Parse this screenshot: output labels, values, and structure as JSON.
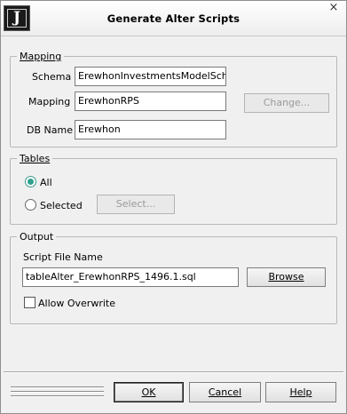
{
  "window": {
    "title": "Generate Alter Scripts",
    "logo_letter": "J",
    "close_symbol": "×"
  },
  "mapping": {
    "legend": "Mapping",
    "schema_label": "Schema",
    "schema_value": "ErewhonInvestmentsModelSchema",
    "mapping_label": "Mapping",
    "mapping_value": "ErewhonRPS",
    "change_button": "Change...",
    "dbname_label": "DB Name",
    "dbname_value": "Erewhon"
  },
  "tables": {
    "legend": "Tables",
    "all_label": "All",
    "all_selected": true,
    "selected_label": "Selected",
    "select_button": "Select..."
  },
  "output": {
    "legend": "Output",
    "script_file_label": "Script File Name",
    "script_file_value": "tableAlter_ErewhonRPS_1496.1.sql",
    "browse_button": "Browse",
    "allow_overwrite_label": "Allow Overwrite",
    "allow_overwrite_checked": false
  },
  "footer": {
    "ok_button": "OK",
    "cancel_button": "Cancel",
    "help_button": "Help"
  },
  "colors": {
    "radio_accent": "#2fa08e",
    "dialog_bg": "#f0f0f0"
  }
}
